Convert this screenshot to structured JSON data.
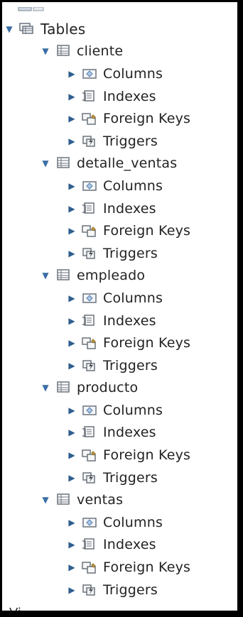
{
  "tree": {
    "root": {
      "label": "Tables",
      "icon": "tables-folder-icon",
      "expanded": true
    },
    "tables": [
      {
        "label": "cliente",
        "icon": "table-icon",
        "expanded": true,
        "children": [
          {
            "label": "Columns",
            "icon": "columns-icon"
          },
          {
            "label": "Indexes",
            "icon": "indexes-icon"
          },
          {
            "label": "Foreign Keys",
            "icon": "foreign-keys-icon"
          },
          {
            "label": "Triggers",
            "icon": "triggers-icon"
          }
        ]
      },
      {
        "label": "detalle_ventas",
        "icon": "table-icon",
        "expanded": true,
        "children": [
          {
            "label": "Columns",
            "icon": "columns-icon"
          },
          {
            "label": "Indexes",
            "icon": "indexes-icon"
          },
          {
            "label": "Foreign Keys",
            "icon": "foreign-keys-icon"
          },
          {
            "label": "Triggers",
            "icon": "triggers-icon"
          }
        ]
      },
      {
        "label": "empleado",
        "icon": "table-icon",
        "expanded": true,
        "children": [
          {
            "label": "Columns",
            "icon": "columns-icon"
          },
          {
            "label": "Indexes",
            "icon": "indexes-icon"
          },
          {
            "label": "Foreign Keys",
            "icon": "foreign-keys-icon"
          },
          {
            "label": "Triggers",
            "icon": "triggers-icon"
          }
        ]
      },
      {
        "label": "producto",
        "icon": "table-icon",
        "expanded": true,
        "children": [
          {
            "label": "Columns",
            "icon": "columns-icon"
          },
          {
            "label": "Indexes",
            "icon": "indexes-icon"
          },
          {
            "label": "Foreign Keys",
            "icon": "foreign-keys-icon"
          },
          {
            "label": "Triggers",
            "icon": "triggers-icon"
          }
        ]
      },
      {
        "label": "ventas",
        "icon": "table-icon",
        "expanded": true,
        "children": [
          {
            "label": "Columns",
            "icon": "columns-icon"
          },
          {
            "label": "Indexes",
            "icon": "indexes-icon"
          },
          {
            "label": "Foreign Keys",
            "icon": "foreign-keys-icon"
          },
          {
            "label": "Triggers",
            "icon": "triggers-icon"
          }
        ]
      }
    ]
  },
  "partial": {
    "top_text": "",
    "bottom_text": "Vi"
  },
  "colors": {
    "frame": "#000000",
    "background": "#ffffff",
    "text": "#222222",
    "toggle": "#3a6ea5"
  }
}
